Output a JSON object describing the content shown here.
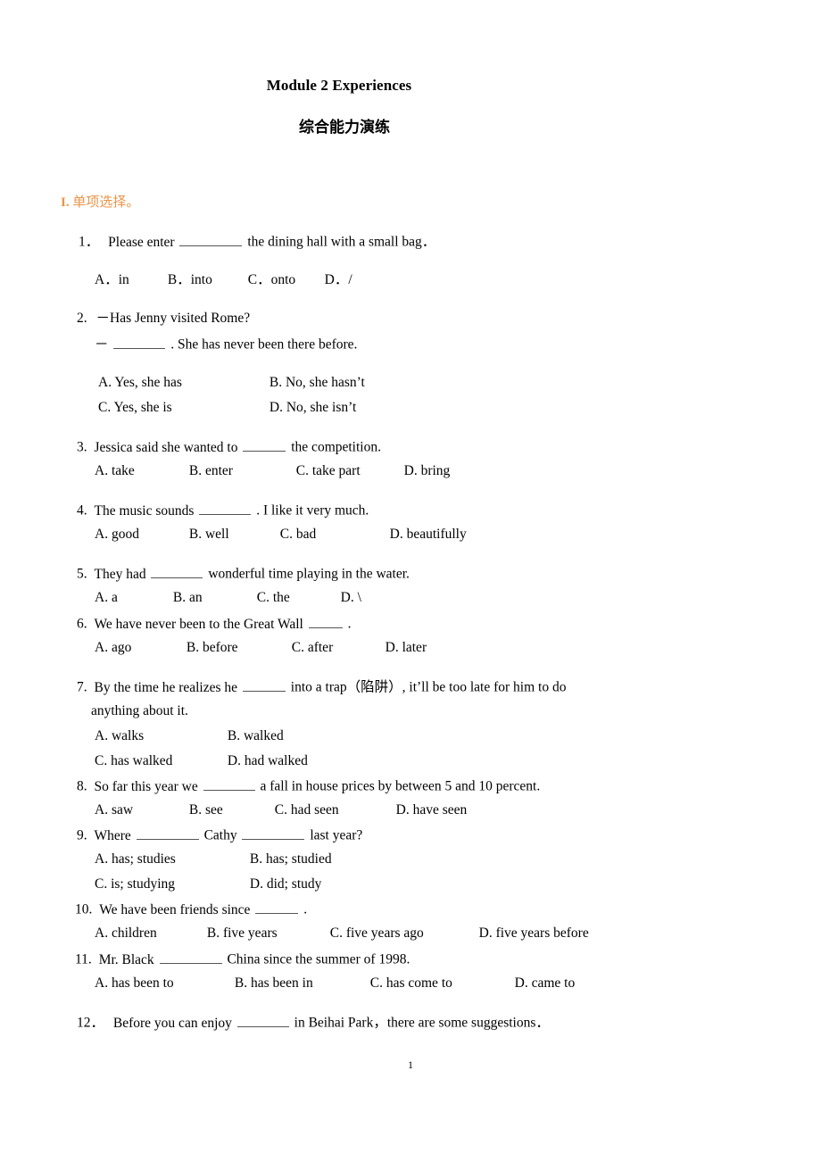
{
  "document": {
    "title": "Module 2 Experiences",
    "subtitle": "综合能力演练",
    "page_number": "1",
    "accent_color": "#E8954A"
  },
  "section": {
    "numeral": "I.",
    "label": "单项选择。"
  },
  "questions": [
    {
      "number": "1．",
      "stem_before": "Please enter",
      "stem_after": "the dining hall with a small bag．",
      "options": [
        "A．in",
        "B．into",
        "C．onto",
        "D．/"
      ]
    },
    {
      "number": "2.",
      "line1": "－Has Jenny visited Rome?",
      "line2_before": "－",
      "line2_after": ". She has never been there before.",
      "options": [
        "A. Yes, she has",
        "B. No, she hasn’t",
        "C. Yes, she is",
        "D. No, she isn’t"
      ]
    },
    {
      "number": "3.",
      "stem_before": "Jessica said she wanted to",
      "stem_after": "the competition.",
      "options": [
        "A. take",
        "B. enter",
        "C. take part",
        "D. bring"
      ]
    },
    {
      "number": "4.",
      "stem_before": "The music sounds",
      "stem_after": ". I like it very much.",
      "options": [
        "A. good",
        "B. well",
        "C. bad",
        "D. beautifully"
      ]
    },
    {
      "number": "5.",
      "stem_before": "They had",
      "stem_after": "wonderful time playing in the water.",
      "options": [
        "A. a",
        "B. an",
        "C. the",
        "D. \\"
      ]
    },
    {
      "number": "6.",
      "stem_before": "We have never been to the Great Wall",
      "stem_after": ".",
      "options": [
        "A. ago",
        "B. before",
        "C. after",
        "D. later"
      ]
    },
    {
      "number": "7.",
      "stem_before": "By the time he realizes he",
      "stem_after": "into a trap（陷阱）, it’ll be too late for him to do",
      "stem_line2": "anything about it.",
      "options": [
        "A. walks",
        "B. walked",
        "C. has walked",
        "D. had walked"
      ]
    },
    {
      "number": "8.",
      "stem_before": "So far this year we",
      "stem_after": "a fall in house prices by between 5 and 10 percent.",
      "options": [
        "A. saw",
        "B. see",
        "C. had seen",
        "D. have seen"
      ]
    },
    {
      "number": "9.",
      "stem_before": "Where",
      "stem_middle": "Cathy",
      "stem_after": "last year?",
      "options": [
        "A. has; studies",
        "B. has; studied",
        "C. is; studying",
        "D. did; study"
      ]
    },
    {
      "number": "10.",
      "stem_before": "We have been friends since",
      "stem_after": ".",
      "options": [
        "A. children",
        "B. five years",
        "C. five years ago",
        "D. five years before"
      ]
    },
    {
      "number": "11.",
      "stem_before": "Mr. Black",
      "stem_after": "China since the summer of 1998.",
      "options": [
        "A. has been to",
        "B. has been in",
        "C. has come to",
        "D. came to"
      ]
    },
    {
      "number": "12．",
      "stem_before": "Before you can enjoy",
      "stem_after": "in Beihai Park，there are some suggestions．",
      "options": []
    }
  ]
}
